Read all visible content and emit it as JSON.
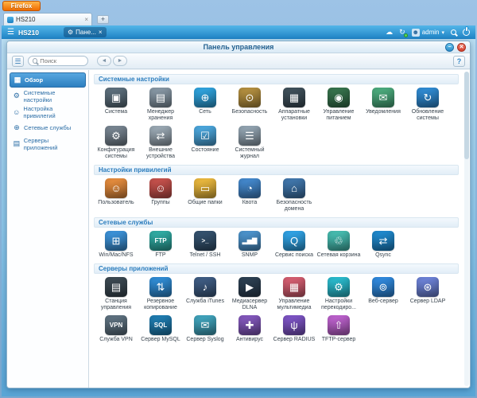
{
  "browser": {
    "menu_button": "Firefox",
    "tab_title": "HS210",
    "new_tab": "+",
    "tab_close": "×"
  },
  "qts": {
    "host": "HS210",
    "taskbar_app": "Пане...",
    "taskbar_close": "×",
    "user": "admin",
    "icons": {
      "burger": "☰",
      "cloud": "☁",
      "tasks": "↻",
      "avatar": "☻",
      "caret": "▾",
      "chip_gear": "⚙"
    }
  },
  "window": {
    "title": "Панель управления",
    "search_placeholder": "Поиск",
    "minimize": "−",
    "close": "✕",
    "help": "?",
    "back": "◄",
    "forward": "►",
    "sidebar_toggle": "☰"
  },
  "sidebar": {
    "items": [
      {
        "label": "Обзор",
        "icon": "overview-icon",
        "glyph": "▦",
        "selected": true
      },
      {
        "label": "Системные настройки",
        "icon": "system-settings-icon",
        "glyph": "⚙",
        "selected": false
      },
      {
        "label": "Настройка привилегий",
        "icon": "privileges-icon",
        "glyph": "☺",
        "selected": false
      },
      {
        "label": "Сетевые службы",
        "icon": "network-services-icon",
        "glyph": "⊕",
        "selected": false
      },
      {
        "label": "Серверы приложений",
        "icon": "app-servers-icon",
        "glyph": "▤",
        "selected": false
      }
    ]
  },
  "sections": [
    {
      "title": "Системные настройки",
      "items": [
        {
          "label": "Система",
          "icon": "system-icon",
          "glyph": "▣",
          "color": "#5b6d7a"
        },
        {
          "label": "Менеджер хранения",
          "icon": "storage-manager-icon",
          "glyph": "▤",
          "color": "#8494a1"
        },
        {
          "label": "Сеть",
          "icon": "network-icon",
          "glyph": "⊕",
          "color": "#2e9fd8"
        },
        {
          "label": "Безопасность",
          "icon": "security-icon",
          "glyph": "⊙",
          "color": "#b08c3e"
        },
        {
          "label": "Аппаратные установки",
          "icon": "hardware-icon",
          "glyph": "▦",
          "color": "#3e4e58"
        },
        {
          "label": "Управление питанием",
          "icon": "power-management-icon",
          "glyph": "◉",
          "color": "#35704a"
        },
        {
          "label": "Уведомления",
          "icon": "notifications-icon",
          "glyph": "✉",
          "color": "#4aa77a"
        },
        {
          "label": "Обновление системы",
          "icon": "system-update-icon",
          "glyph": "↻",
          "color": "#2f88ce"
        },
        {
          "label": "Конфигурация системы",
          "icon": "system-config-icon",
          "glyph": "⚙",
          "color": "#75828e"
        },
        {
          "label": "Внешние устройства",
          "icon": "external-device-icon",
          "glyph": "⇄",
          "color": "#97a5b0"
        },
        {
          "label": "Состояние",
          "icon": "system-status-icon",
          "glyph": "☑",
          "color": "#4aa3d8"
        },
        {
          "label": "Системный журнал",
          "icon": "system-logs-icon",
          "glyph": "☰",
          "color": "#8fa0ad"
        }
      ]
    },
    {
      "title": "Настройки привилегий",
      "items": [
        {
          "label": "Пользователь",
          "icon": "users-icon",
          "glyph": "☺",
          "color": "#e0893c"
        },
        {
          "label": "Группы",
          "icon": "groups-icon",
          "glyph": "☺",
          "color": "#c14f4a"
        },
        {
          "label": "Общие папки",
          "icon": "shared-folders-icon",
          "glyph": "▭",
          "color": "#e5b43c"
        },
        {
          "label": "Квота",
          "icon": "quota-icon",
          "glyph": "◔",
          "color": "#4285c8"
        },
        {
          "label": "Безопасность домена",
          "icon": "domain-security-icon",
          "glyph": "⌂",
          "color": "#3f74a8"
        }
      ]
    },
    {
      "title": "Сетевые службы",
      "items": [
        {
          "label": "Win/Mac/NFS",
          "icon": "win-mac-nfs-icon",
          "glyph": "⊞",
          "color": "#3b8fd4"
        },
        {
          "label": "FTP",
          "icon": "ftp-icon",
          "glyph": "FTP",
          "color": "#2fa8a0"
        },
        {
          "label": "Telnet / SSH",
          "icon": "telnet-ssh-icon",
          "glyph": ">_",
          "color": "#33506c"
        },
        {
          "label": "SNMP",
          "icon": "snmp-icon",
          "glyph": "▂▅▇",
          "color": "#4a90c8"
        },
        {
          "label": "Сервис поиска",
          "icon": "search-service-icon",
          "glyph": "Q",
          "color": "#2f9fe0"
        },
        {
          "label": "Сетевая корзина",
          "icon": "network-recycle-bin-icon",
          "glyph": "♲",
          "color": "#45b8ac"
        },
        {
          "label": "Qsync",
          "icon": "qsync-icon",
          "glyph": "⇄",
          "color": "#1f86c9"
        }
      ]
    },
    {
      "title": "Серверы приложений",
      "items": [
        {
          "label": "Станция управления",
          "icon": "management-station-icon",
          "glyph": "▤",
          "color": "#3a4750"
        },
        {
          "label": "Резервное копирование",
          "icon": "backup-icon",
          "glyph": "⇅",
          "color": "#2f89d0"
        },
        {
          "label": "Служба iTunes",
          "icon": "itunes-icon",
          "glyph": "♪",
          "color": "#3d5a80"
        },
        {
          "label": "Медиасервер DLNA",
          "icon": "dlna-icon",
          "glyph": "▶",
          "color": "#2b3e50"
        },
        {
          "label": "Управление мультимедиа",
          "icon": "multimedia-icon",
          "glyph": "▦",
          "color": "#d05c6e"
        },
        {
          "label": "Настройки перекодиро...",
          "icon": "transcode-icon",
          "glyph": "⚙",
          "color": "#29b6c8"
        },
        {
          "label": "Веб-сервер",
          "icon": "web-server-icon",
          "glyph": "⊚",
          "color": "#2f86d8"
        },
        {
          "label": "Сервер LDAP",
          "icon": "ldap-icon",
          "glyph": "⊛",
          "color": "#6a7fd2"
        },
        {
          "label": "Служба VPN",
          "icon": "vpn-icon",
          "glyph": "VPN",
          "color": "#5c6f7d"
        },
        {
          "label": "Сервер MySQL",
          "icon": "mysql-icon",
          "glyph": "SQL",
          "color": "#1f7aad"
        },
        {
          "label": "Сервер Syslog",
          "icon": "syslog-icon",
          "glyph": "✉",
          "color": "#3fa0b8"
        },
        {
          "label": "Антивирус",
          "icon": "antivirus-icon",
          "glyph": "✚",
          "color": "#8056b8"
        },
        {
          "label": "Сервер RADIUS",
          "icon": "radius-icon",
          "glyph": "ψ",
          "color": "#7a52c0"
        },
        {
          "label": "TFTP-сервер",
          "icon": "tftp-icon",
          "glyph": "⇧",
          "color": "#b85fc8"
        }
      ]
    }
  ]
}
